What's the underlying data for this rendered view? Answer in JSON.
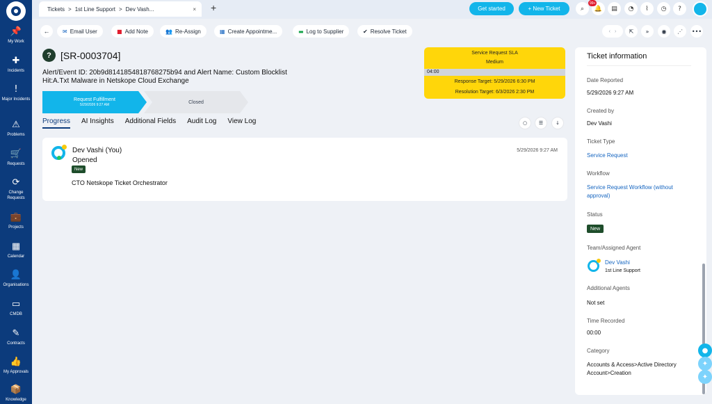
{
  "sidebar": {
    "items": [
      {
        "label": "My Work",
        "icon": "pin-icon",
        "glyph": "📌"
      },
      {
        "label": "Incidents",
        "icon": "bandage-icon",
        "glyph": "✚"
      },
      {
        "label": "Major Incidents",
        "icon": "exclamation-icon",
        "glyph": "!"
      },
      {
        "label": "Problems",
        "icon": "warning-icon",
        "glyph": "⚠"
      },
      {
        "label": "Requests",
        "icon": "cart-icon",
        "glyph": "🛒"
      },
      {
        "label": "Change Requests",
        "icon": "refresh-icon",
        "glyph": "⟳"
      },
      {
        "label": "Projects",
        "icon": "briefcase-icon",
        "glyph": "💼"
      },
      {
        "label": "Calendar",
        "icon": "calendar-icon",
        "glyph": "▦"
      },
      {
        "label": "Organisations",
        "icon": "person-icon",
        "glyph": "👤"
      },
      {
        "label": "CMDB",
        "icon": "laptop-icon",
        "glyph": "▭"
      },
      {
        "label": "Contracts",
        "icon": "contract-icon",
        "glyph": "✎"
      },
      {
        "label": "My Approvals",
        "icon": "thumbs-up-icon",
        "glyph": "👍"
      },
      {
        "label": "Knowledge",
        "icon": "book-icon",
        "glyph": "📦"
      }
    ]
  },
  "topbar": {
    "breadcrumb": [
      "Tickets",
      "1st Line Support",
      "Dev Vash..."
    ],
    "sep": ">",
    "close": "×",
    "new_tab": "+",
    "get_started": "Get started",
    "new_ticket": "+ New Ticket",
    "notification_count": "99+"
  },
  "toolbar": {
    "back": "←",
    "email_user": "Email User",
    "add_note": "Add Note",
    "reassign": "Re-Assign",
    "create_appointment": "Create Appointme...",
    "log_to_supplier": "Log to Supplier",
    "resolve_ticket": "Resolve Ticket",
    "pager": [
      "‹",
      "›"
    ]
  },
  "ticket": {
    "icon": "?",
    "id": "[SR-0003704]",
    "alert_line1": "Alert/Event ID: 20b9d81418548187682 75b94 and Alert Name: Custom Blocklist",
    "alert_line1_exact": "Alert/Event ID: 20b9d8141854818768275b94 and Alert Name: Custom Blocklist",
    "alert_line2": "Hit:A.Txt Malware in Netskope Cloud Exchange"
  },
  "stages": {
    "current": {
      "label": "Request Fulfillment",
      "date": "5/29/2026 9:27 AM"
    },
    "next": {
      "label": "Closed"
    }
  },
  "sla": {
    "title": "Service Request SLA",
    "priority": "Medium",
    "elapsed": "04:00",
    "response": "Response Target: 5/29/2026 6:30 PM",
    "resolution": "Resolution Target: 6/3/2026 2:30 PM",
    "color": "#ffd60a"
  },
  "tabs": [
    "Progress",
    "AI Insights",
    "Additional Fields",
    "Audit Log",
    "View Log"
  ],
  "activity": {
    "name": "Dev Vashi (You)",
    "action": "Opened",
    "badge": "New",
    "time": "5/29/2026 9:27 AM",
    "message": "CTO Netskope Ticket Orchestrator"
  },
  "info": {
    "title": "Ticket information",
    "date_reported_label": "Date Reported",
    "date_reported": "5/29/2026 9:27 AM",
    "created_by_label": "Created by",
    "created_by": "Dev Vashi",
    "ticket_type_label": "Ticket Type",
    "ticket_type": "Service Request",
    "workflow_label": "Workflow",
    "workflow": "Service Request Workflow (without approval)",
    "status_label": "Status",
    "status": "New",
    "team_label": "Team/Assigned Agent",
    "agent": "Dev Vashi",
    "team": "1st Line Support",
    "additional_agents_label": "Additional Agents",
    "additional_agents": "Not set",
    "time_recorded_label": "Time Recorded",
    "time_recorded": "00:00",
    "category_label": "Category",
    "category": "Accounts & Access>Active Directory Account>Creation"
  },
  "colors": {
    "sidebar": "#0c3b7c",
    "accent": "#12b5ea",
    "status_green": "#1e4d2b",
    "link": "#1565c0"
  }
}
